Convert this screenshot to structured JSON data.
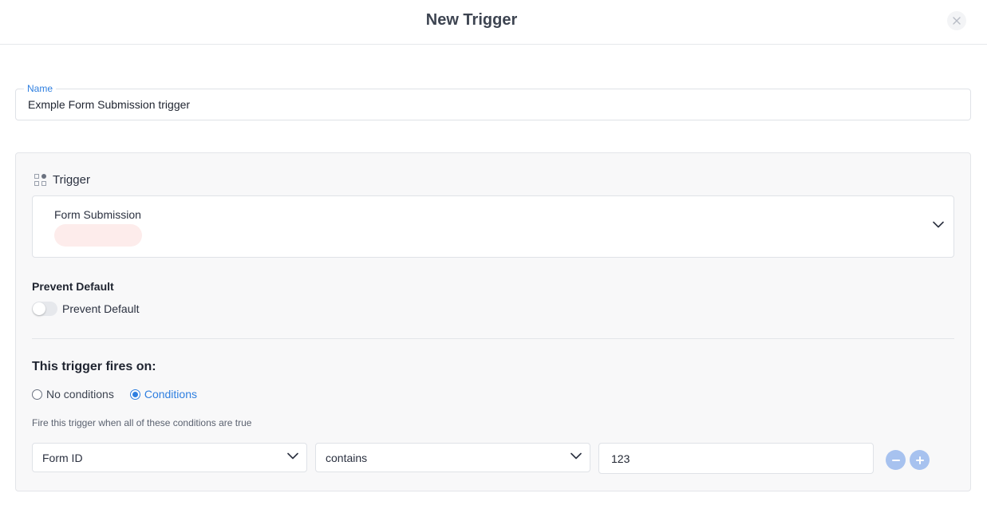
{
  "header": {
    "title": "New Trigger",
    "close_icon": "close-icon"
  },
  "name_field": {
    "label": "Name",
    "value": "Exmple Form Submission trigger"
  },
  "trigger_section": {
    "icon": "grid-icon",
    "heading": "Trigger",
    "selected_type": "Form Submission",
    "chevron_icon": "chevron-down-icon"
  },
  "prevent_default": {
    "title": "Prevent Default",
    "toggle_label": "Prevent Default",
    "enabled": false
  },
  "fires_on": {
    "heading": "This trigger fires on:",
    "options": [
      {
        "label": "No conditions",
        "selected": false
      },
      {
        "label": "Conditions",
        "selected": true
      }
    ],
    "hint": "Fire this trigger when all of these conditions are true"
  },
  "condition": {
    "field": "Form ID",
    "operator": "contains",
    "value": "123",
    "remove_icon": "minus-circle-icon",
    "add_icon": "plus-circle-icon"
  },
  "colors": {
    "accent": "#2f7fe0",
    "button_light": "#a7c2ef",
    "pill": "#fdeceb"
  }
}
